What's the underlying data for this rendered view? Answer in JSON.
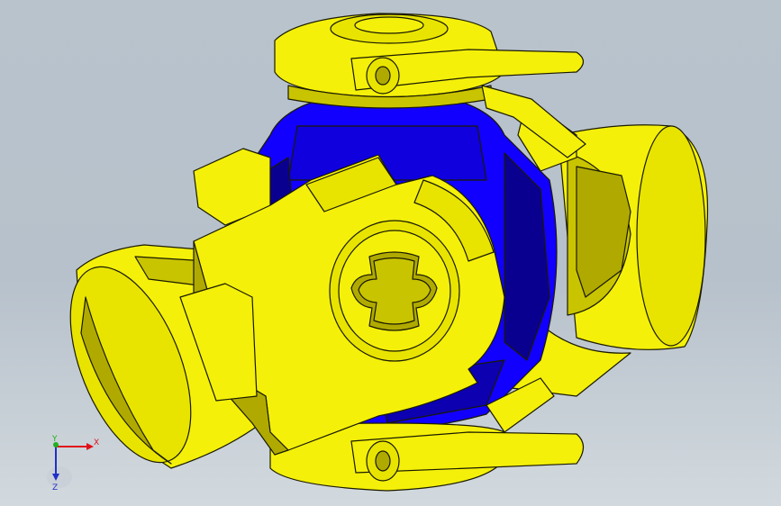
{
  "viewport": {
    "background_top": "#b9c3cc",
    "background_bottom": "#d2d9de"
  },
  "model": {
    "yoke_color": "#f4f00a",
    "yoke_shadow": "#b0aa00",
    "yoke_dark": "#6d6a00",
    "cross_color": "#1200ff",
    "cross_shadow": "#0a0090",
    "edge_color": "#1a1a00"
  },
  "triad": {
    "x_label": "X",
    "y_label": "Y",
    "z_label": "Z",
    "x_color": "#e0101a",
    "y_color": "#1fb01f",
    "z_color": "#1f30c8"
  }
}
